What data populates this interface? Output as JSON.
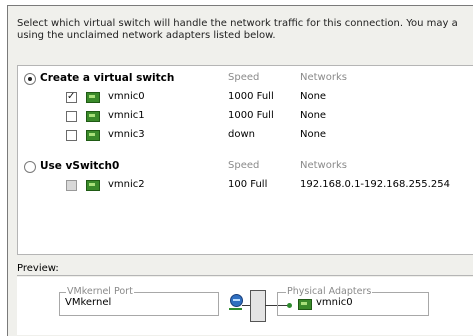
{
  "intro_text": "Select which virtual switch will handle the network traffic for this connection. You may a using the unclaimed network adapters listed below.",
  "groups": [
    {
      "label": "Create a virtual switch",
      "selected": true,
      "speed_header": "Speed",
      "networks_header": "Networks",
      "adapters": [
        {
          "name": "vmnic0",
          "checked": true,
          "speed": "1000 Full",
          "networks": "None"
        },
        {
          "name": "vmnic1",
          "checked": false,
          "speed": "1000 Full",
          "networks": "None"
        },
        {
          "name": "vmnic3",
          "checked": false,
          "speed": "down",
          "networks": "None"
        }
      ]
    },
    {
      "label": "Use vSwitch0",
      "selected": false,
      "speed_header": "Speed",
      "networks_header": "Networks",
      "adapters": [
        {
          "name": "vmnic2",
          "checked": false,
          "disabled": true,
          "speed": "100 Full",
          "networks": "192.168.0.1-192.168.255.254"
        }
      ]
    }
  ],
  "preview": {
    "label": "Preview:",
    "vmkernel_group_title": "VMkernel Port",
    "vmkernel_port": "VMkernel",
    "physical_group_title": "Physical Adapters",
    "physical_adapter": "vmnic0"
  },
  "icons": {
    "nic": "network-adapter-icon",
    "port": "vmkernel-port-icon",
    "switch": "virtual-switch-icon"
  },
  "colors": {
    "nic_green": "#3a8a2a",
    "port_blue": "#2f6fc0",
    "header_gray": "#8a8a8a"
  }
}
